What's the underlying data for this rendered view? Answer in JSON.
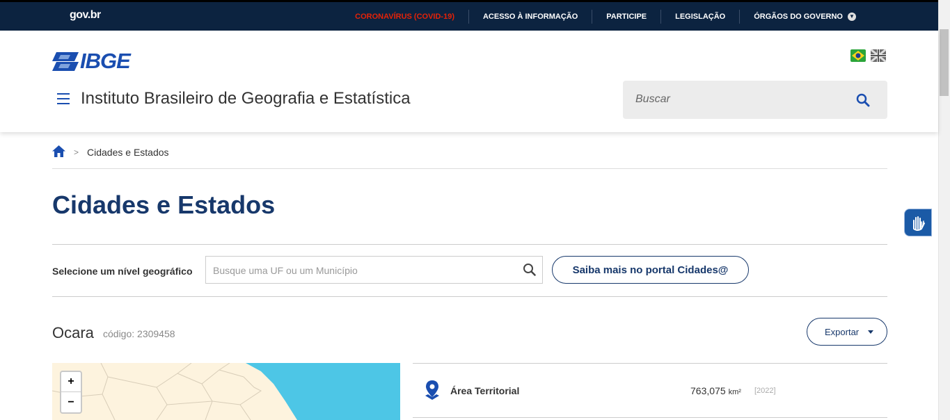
{
  "govbar": {
    "logo": "gov.br",
    "items": [
      "CORONAVÍRUS (COVID-19)",
      "ACESSO À INFORMAÇÃO",
      "PARTICIPE",
      "LEGISLAÇÃO",
      "ÓRGÃOS DO GOVERNO"
    ]
  },
  "header": {
    "logo_text": "IBGE",
    "site_title": "Instituto Brasileiro de Geografia e Estatística",
    "search_placeholder": "Buscar"
  },
  "breadcrumb": {
    "sep": ">",
    "current": "Cidades e Estados"
  },
  "page": {
    "title": "Cidades e Estados",
    "select_label": "Selecione um nível geográfico",
    "geo_placeholder": "Busque uma UF ou um Município",
    "saiba_label": "Saiba mais no portal Cidades@"
  },
  "city": {
    "name": "Ocara",
    "code": "código: 2309458",
    "export_label": "Exportar"
  },
  "map": {
    "zoom_in": "+",
    "zoom_out": "−"
  },
  "info": {
    "label": "Área Territorial",
    "value": "763,075",
    "unit": "km²",
    "year": "[2022]"
  },
  "colors": {
    "gov_bar": "#0c2340",
    "covid": "#e52207",
    "brand": "#1a4eb0",
    "title": "#17386b",
    "sea": "#4dc6e6",
    "land": "#fdf3de"
  }
}
